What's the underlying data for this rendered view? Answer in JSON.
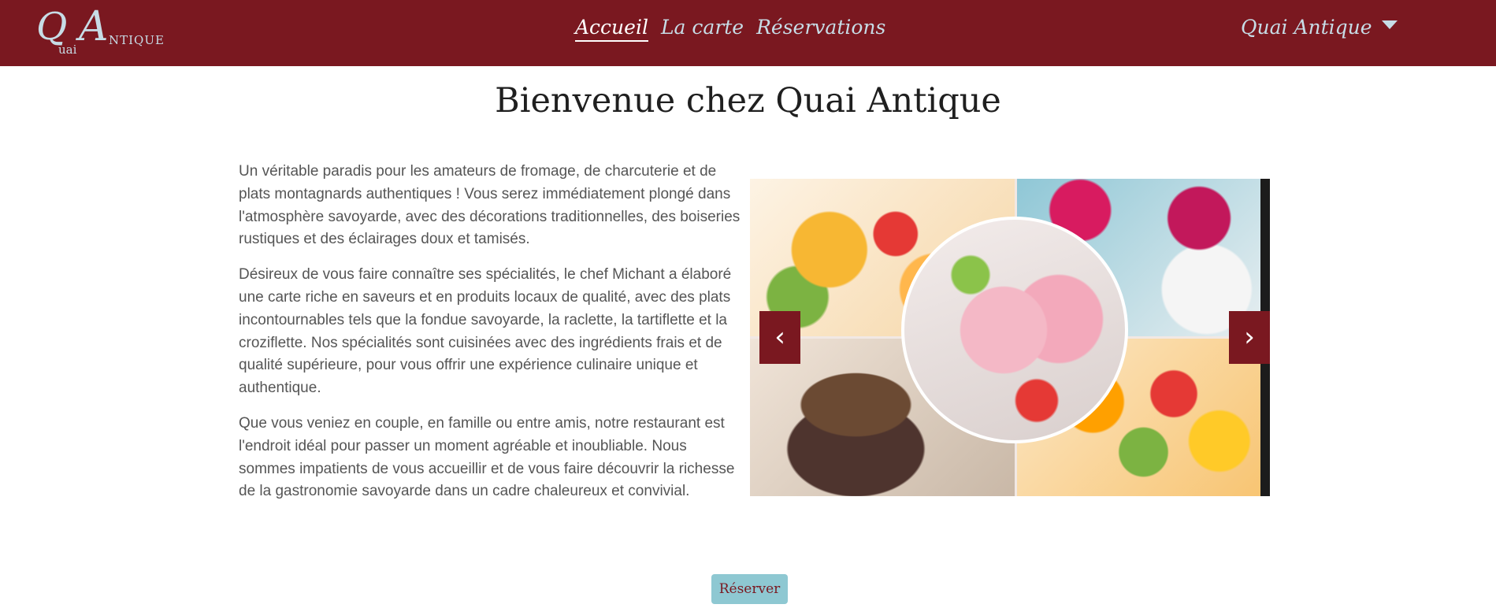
{
  "header": {
    "logo": {
      "q": "Q",
      "a": "A",
      "uai": "uai",
      "ntique": "NTIQUE"
    },
    "nav": [
      {
        "label": "Accueil",
        "active": true
      },
      {
        "label": "La carte",
        "active": false
      },
      {
        "label": "Réservations",
        "active": false
      }
    ],
    "account_label": "Quai Antique",
    "account_icon": "caret-down-icon"
  },
  "main": {
    "title": "Bienvenue chez Quai Antique",
    "paragraphs": [
      "Un véritable paradis pour les amateurs de fromage, de charcuterie et de plats montagnards authentiques ! Vous serez immédiatement plongé dans l'atmosphère savoyarde, avec des décorations traditionnelles, des boiseries rustiques et des éclairages doux et tamisés.",
      "Désireux de vous faire connaître ses spécialités, le chef Michant a élaboré une carte riche en saveurs et en produits locaux de qualité, avec des plats incontournables tels que la fondue savoyarde, la raclette, la tartiflette et la croziflette. Nos spécialités sont cuisinées avec des ingrédients frais et de qualité supérieure, pour vous offrir une expérience culinaire unique et authentique.",
      "Que vous veniez en couple, en famille ou entre amis, notre restaurant est l'endroit idéal pour passer un moment agréable et inoubliable. Nous sommes impatients de vous accueillir et de vous faire découvrir la richesse de la gastronomie savoyarde dans un cadre chaleureux et convivial."
    ],
    "carousel": {
      "prev_icon": "‹",
      "next_icon": "›"
    },
    "reserve_label": "Réserver"
  },
  "colors": {
    "brand": "#7a1820",
    "accent": "#8ec8d2",
    "nav_text": "#c7dce6"
  }
}
